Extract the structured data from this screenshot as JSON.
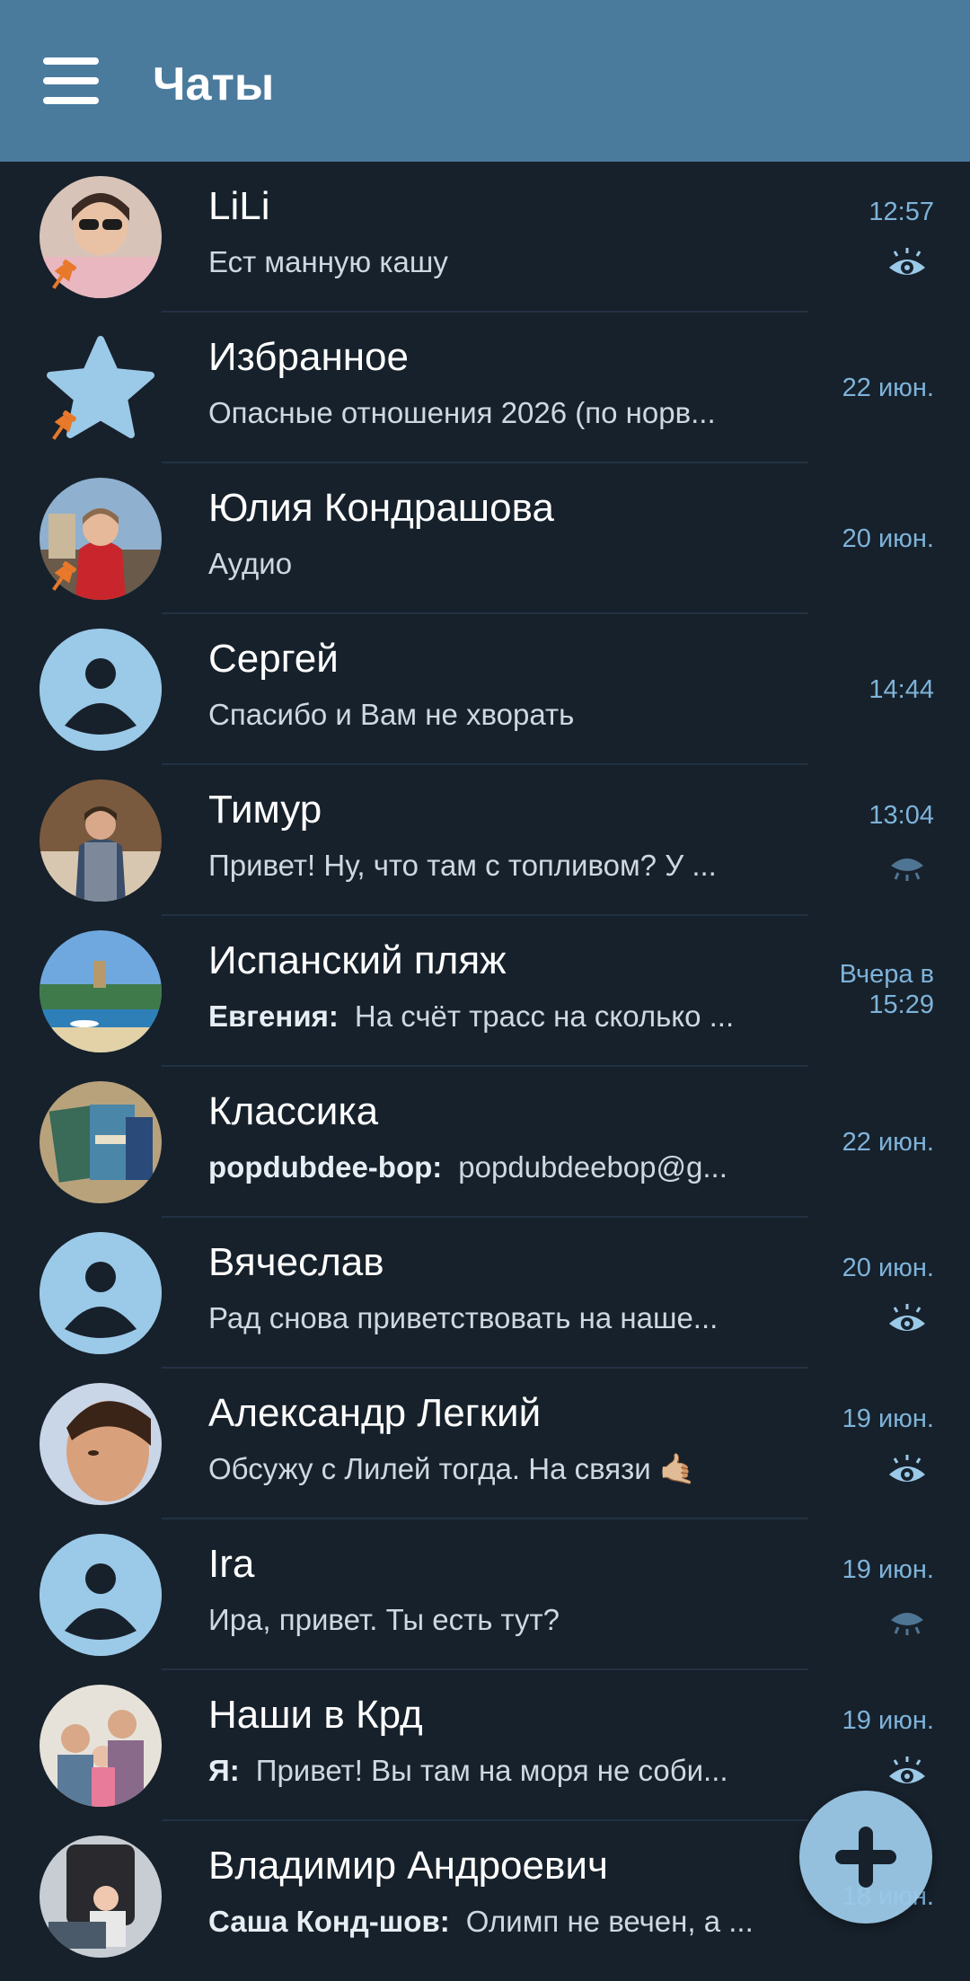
{
  "header": {
    "title": "Чаты"
  },
  "colors": {
    "header_bg": "#4a7b9d",
    "list_bg": "#17212b",
    "accent": "#9bc9e8",
    "time_text": "#7eb3da"
  },
  "chats": [
    {
      "name": "LiLi",
      "sender": "",
      "preview": "Ест манную кашу",
      "time": "12:57",
      "pinned": true,
      "status_icon": "eye-open-icon",
      "avatar": "photo"
    },
    {
      "name": "Избранное",
      "sender": "",
      "preview": "Опасные отношения 2026 (по норв...",
      "time": "22 июн.",
      "pinned": true,
      "status_icon": "",
      "avatar": "star-icon"
    },
    {
      "name": "Юлия Кондрашова",
      "sender": "",
      "preview": "Аудио",
      "time": "20 июн.",
      "pinned": true,
      "status_icon": "",
      "avatar": "photo"
    },
    {
      "name": "Сергей",
      "sender": "",
      "preview": "Спасибо и Вам не хворать",
      "time": "14:44",
      "pinned": false,
      "status_icon": "",
      "avatar": "default-user-icon"
    },
    {
      "name": "Тимур",
      "sender": "",
      "preview": "Привет! Ну, что там с топливом? У ...",
      "time": "13:04",
      "pinned": false,
      "status_icon": "eye-closed-icon",
      "avatar": "photo"
    },
    {
      "name": "Испанский пляж",
      "sender": "Евгения:",
      "preview": "На счёт трасс на сколько ...",
      "time": "Вчера в 15:29",
      "pinned": false,
      "status_icon": "",
      "avatar": "photo"
    },
    {
      "name": "Классика",
      "sender": "popdubdee-bop:",
      "preview": "popdubdeebop@g...",
      "time": "22 июн.",
      "pinned": false,
      "status_icon": "",
      "avatar": "photo"
    },
    {
      "name": "Вячеслав",
      "sender": "",
      "preview": "Рад снова приветствовать на наше...",
      "time": "20 июн.",
      "pinned": false,
      "status_icon": "eye-open-icon",
      "avatar": "default-user-icon"
    },
    {
      "name": "Александр Легкий",
      "sender": "",
      "preview": "Обсужу с Лилей тогда. На связи 🤙🏼",
      "time": "19 июн.",
      "pinned": false,
      "status_icon": "eye-open-icon",
      "avatar": "photo"
    },
    {
      "name": "Ira",
      "sender": "",
      "preview": "Ира, привет. Ты есть тут?",
      "time": "19 июн.",
      "pinned": false,
      "status_icon": "eye-closed-icon",
      "avatar": "default-user-icon"
    },
    {
      "name": "Наши в Крд",
      "sender": "Я:",
      "preview": "Привет! Вы там на моря не соби...",
      "time": "19 июн.",
      "pinned": false,
      "status_icon": "eye-open-icon",
      "avatar": "photo"
    },
    {
      "name": "Владимир Андроевич",
      "sender": "Саша Конд-шов:",
      "preview": "Олимп не вечен, а ...",
      "time": "18 июн.",
      "pinned": false,
      "status_icon": "",
      "avatar": "photo"
    }
  ]
}
